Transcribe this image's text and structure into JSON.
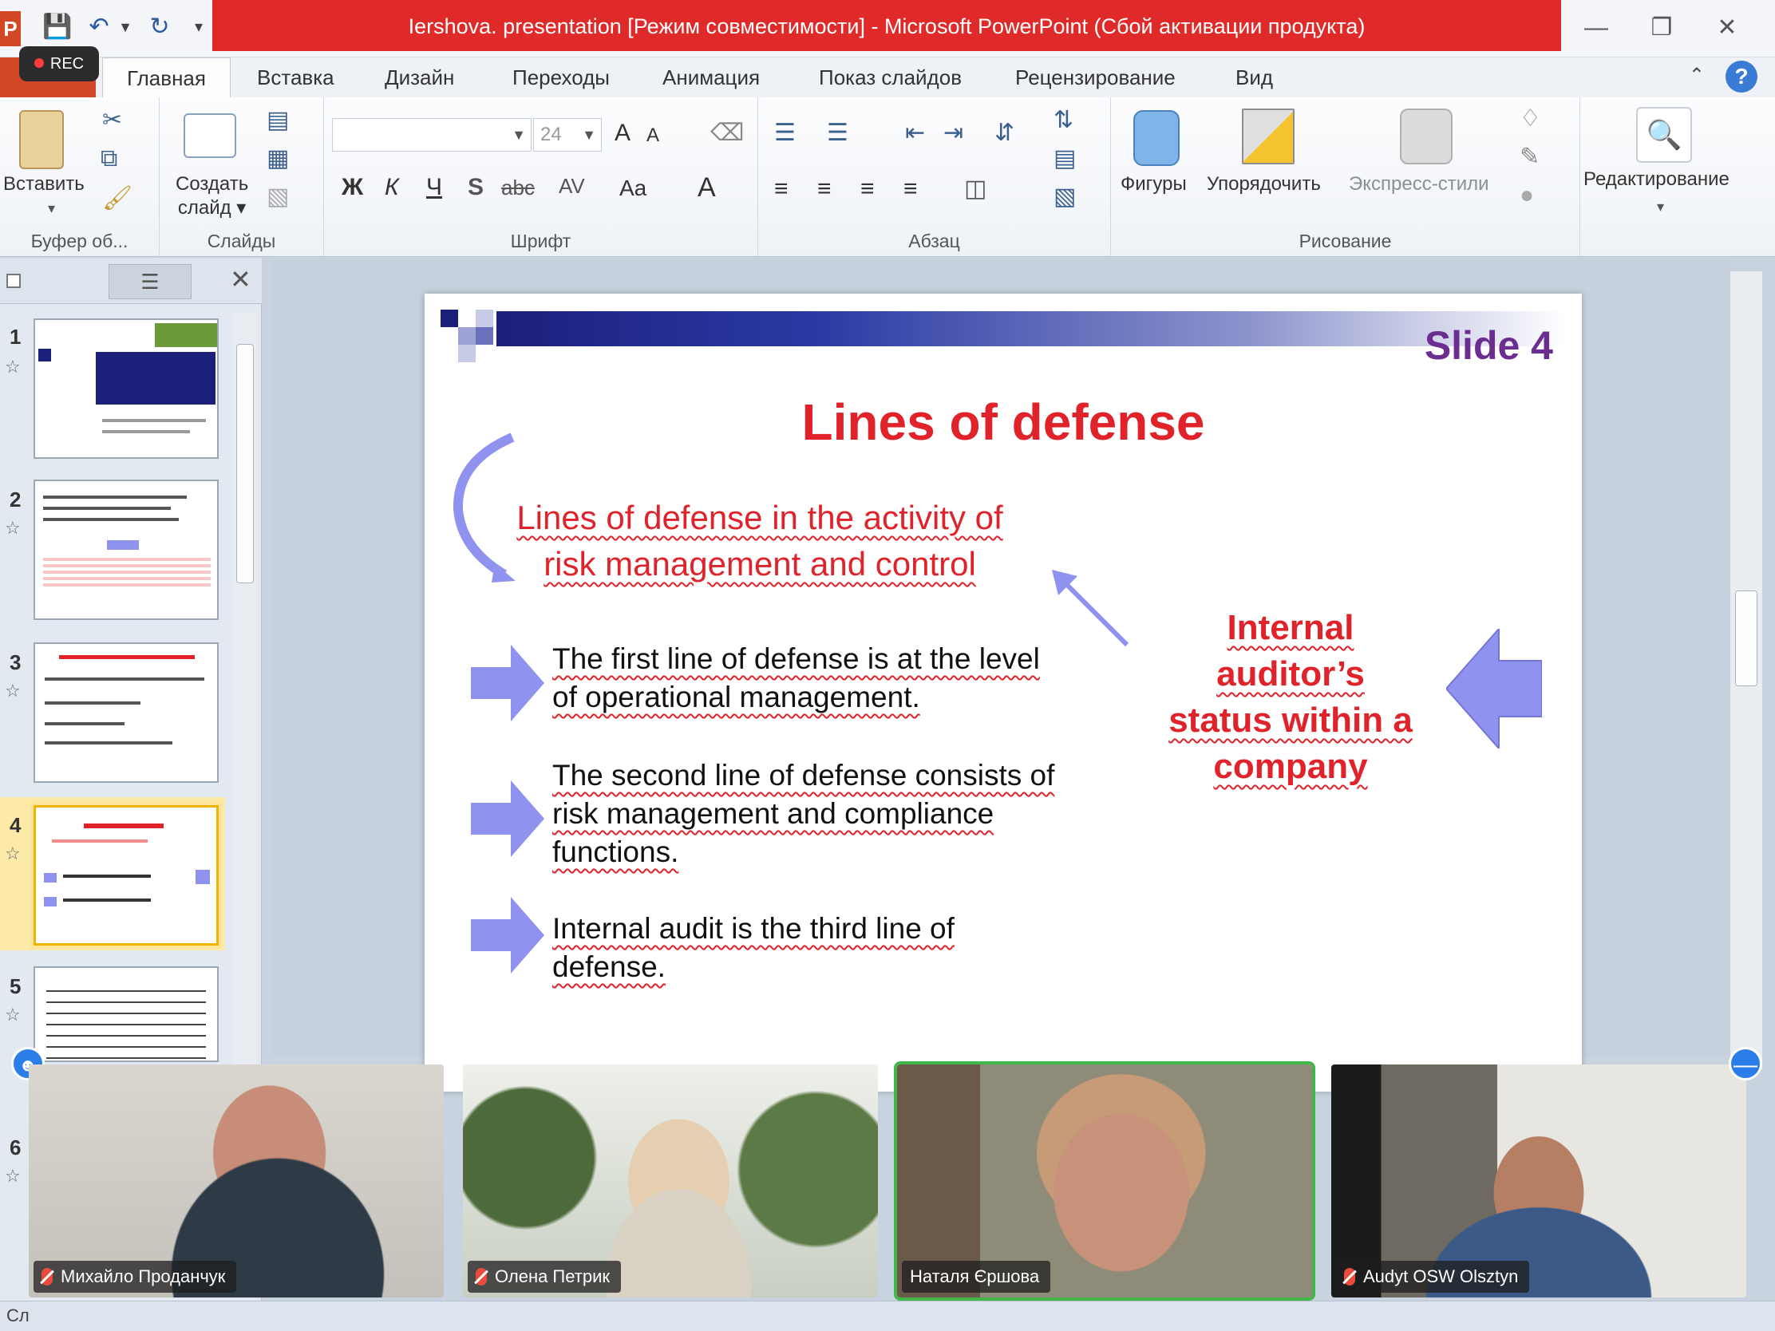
{
  "window": {
    "title": "Iershova. presentation [Режим совместимости] - Microsoft PowerPoint (Сбой активации продукта)",
    "app_icon": "P",
    "recording_badge": "REC"
  },
  "tabs": [
    {
      "label": "Главная",
      "active": true
    },
    {
      "label": "Вставка"
    },
    {
      "label": "Дизайн"
    },
    {
      "label": "Переходы"
    },
    {
      "label": "Анимация"
    },
    {
      "label": "Показ слайдов"
    },
    {
      "label": "Рецензирование"
    },
    {
      "label": "Вид"
    }
  ],
  "ribbon": {
    "clipboard": {
      "label": "Буфер об...",
      "paste": "Вставить"
    },
    "slides": {
      "label": "Слайды",
      "new_slide_1": "Создать",
      "new_slide_2": "слайд"
    },
    "font": {
      "label": "Шрифт",
      "font_name": "",
      "font_size": "24",
      "bold": "Ж",
      "italic": "К",
      "underline": "Ч",
      "shadow": "S",
      "strike": "abc",
      "spacing": "AV",
      "case": "Aa",
      "grow": "A",
      "shrink": "A",
      "color": "A"
    },
    "paragraph": {
      "label": "Абзац"
    },
    "drawing": {
      "label": "Рисование",
      "shapes": "Фигуры",
      "arrange": "Упорядочить",
      "quick_styles": "Экспресс-стили"
    },
    "editing": {
      "label": "Редактирование"
    }
  },
  "slide_pane": {
    "thumbnails": [
      {
        "num": "1"
      },
      {
        "num": "2"
      },
      {
        "num": "3"
      },
      {
        "num": "4",
        "selected": true
      },
      {
        "num": "5"
      },
      {
        "num": "6"
      }
    ]
  },
  "slide": {
    "number_label": "Slide 4",
    "title": "Lines of defense",
    "subtitle_line1": "Lines of defense in the activity of",
    "subtitle_line2": "risk management and control",
    "bullets": [
      {
        "line1": "The first line of defense is at the level",
        "line2": "of operational management."
      },
      {
        "line1": "The second line of defense consists of",
        "line2": "risk management and compliance",
        "line3": "functions."
      },
      {
        "line1": "Internal audit is the third line of",
        "line2": "defense."
      }
    ],
    "status_text": [
      "Internal",
      "auditor’s",
      "status within a",
      "company"
    ]
  },
  "participants": [
    {
      "name": "Михайло Проданчук",
      "muted": true
    },
    {
      "name": "Олена Петрик",
      "muted": true
    },
    {
      "name": "Наталя Єршова",
      "muted": false,
      "active": true
    },
    {
      "name": "Audyt OSW Olsztyn",
      "muted": true
    }
  ],
  "status_bar": {
    "text": "Сл"
  },
  "colors": {
    "title_bar": "#e02a2a",
    "slide_red": "#e0222a",
    "slide_purple": "#6b2d8f",
    "arrow_fill": "#8f92ef",
    "active_speaker": "#43b649"
  }
}
